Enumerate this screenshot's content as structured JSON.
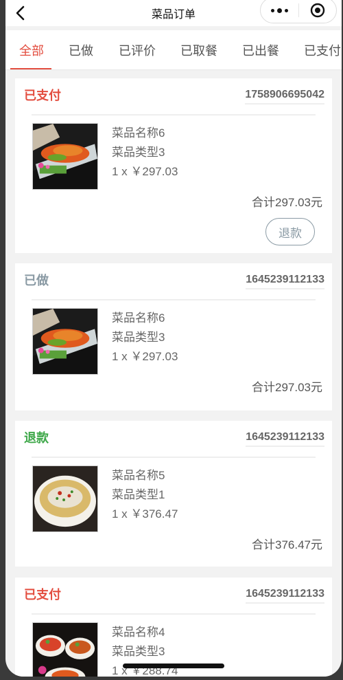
{
  "navbar": {
    "title": "菜品订单"
  },
  "tabs": [
    "全部",
    "已做",
    "已评价",
    "已取餐",
    "已出餐",
    "已支付"
  ],
  "colors": {
    "accent": "#e34d3f",
    "paid": "#e34d3f",
    "done": "#8a9aa4",
    "refund": "#3fa84a"
  },
  "orders": [
    {
      "status": "已支付",
      "status_color": "#e34d3f",
      "order_no": "1758906695042",
      "dish_name": "菜品名称6",
      "dish_type": "菜品类型3",
      "qty_price": "1 x ￥297.03",
      "total": "合计297.03元",
      "action": "退款",
      "image": "salad-platter"
    },
    {
      "status": "已做",
      "status_color": "#8a9aa4",
      "order_no": "1645239112133",
      "dish_name": "菜品名称6",
      "dish_type": "菜品类型3",
      "qty_price": "1 x ￥297.03",
      "total": "合计297.03元",
      "image": "salad-platter"
    },
    {
      "status": "退款",
      "status_color": "#3fa84a",
      "order_no": "1645239112133",
      "dish_name": "菜品名称5",
      "dish_type": "菜品类型1",
      "qty_price": "1 x ￥376.47",
      "total": "合计376.47元",
      "image": "fish-soup"
    },
    {
      "status": "已支付",
      "status_color": "#e34d3f",
      "order_no": "1645239112133",
      "dish_name": "菜品名称4",
      "dish_type": "菜品类型3",
      "qty_price": "1 x ￥288.74",
      "total": "",
      "image": "stir-fry-bowls"
    }
  ]
}
